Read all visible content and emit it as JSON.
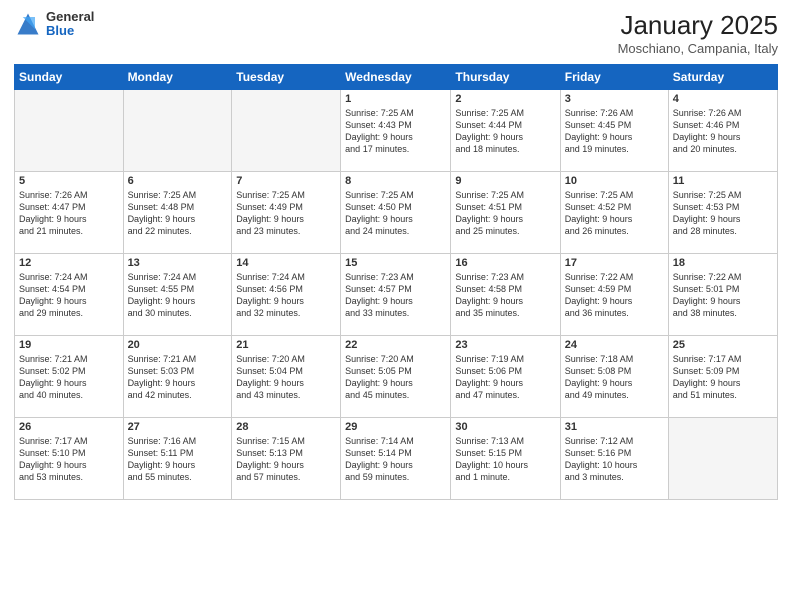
{
  "header": {
    "logo_general": "General",
    "logo_blue": "Blue",
    "month_title": "January 2025",
    "location": "Moschiano, Campania, Italy"
  },
  "days_of_week": [
    "Sunday",
    "Monday",
    "Tuesday",
    "Wednesday",
    "Thursday",
    "Friday",
    "Saturday"
  ],
  "weeks": [
    [
      {
        "num": "",
        "info": ""
      },
      {
        "num": "",
        "info": ""
      },
      {
        "num": "",
        "info": ""
      },
      {
        "num": "1",
        "info": "Sunrise: 7:25 AM\nSunset: 4:43 PM\nDaylight: 9 hours\nand 17 minutes."
      },
      {
        "num": "2",
        "info": "Sunrise: 7:25 AM\nSunset: 4:44 PM\nDaylight: 9 hours\nand 18 minutes."
      },
      {
        "num": "3",
        "info": "Sunrise: 7:26 AM\nSunset: 4:45 PM\nDaylight: 9 hours\nand 19 minutes."
      },
      {
        "num": "4",
        "info": "Sunrise: 7:26 AM\nSunset: 4:46 PM\nDaylight: 9 hours\nand 20 minutes."
      }
    ],
    [
      {
        "num": "5",
        "info": "Sunrise: 7:26 AM\nSunset: 4:47 PM\nDaylight: 9 hours\nand 21 minutes."
      },
      {
        "num": "6",
        "info": "Sunrise: 7:25 AM\nSunset: 4:48 PM\nDaylight: 9 hours\nand 22 minutes."
      },
      {
        "num": "7",
        "info": "Sunrise: 7:25 AM\nSunset: 4:49 PM\nDaylight: 9 hours\nand 23 minutes."
      },
      {
        "num": "8",
        "info": "Sunrise: 7:25 AM\nSunset: 4:50 PM\nDaylight: 9 hours\nand 24 minutes."
      },
      {
        "num": "9",
        "info": "Sunrise: 7:25 AM\nSunset: 4:51 PM\nDaylight: 9 hours\nand 25 minutes."
      },
      {
        "num": "10",
        "info": "Sunrise: 7:25 AM\nSunset: 4:52 PM\nDaylight: 9 hours\nand 26 minutes."
      },
      {
        "num": "11",
        "info": "Sunrise: 7:25 AM\nSunset: 4:53 PM\nDaylight: 9 hours\nand 28 minutes."
      }
    ],
    [
      {
        "num": "12",
        "info": "Sunrise: 7:24 AM\nSunset: 4:54 PM\nDaylight: 9 hours\nand 29 minutes."
      },
      {
        "num": "13",
        "info": "Sunrise: 7:24 AM\nSunset: 4:55 PM\nDaylight: 9 hours\nand 30 minutes."
      },
      {
        "num": "14",
        "info": "Sunrise: 7:24 AM\nSunset: 4:56 PM\nDaylight: 9 hours\nand 32 minutes."
      },
      {
        "num": "15",
        "info": "Sunrise: 7:23 AM\nSunset: 4:57 PM\nDaylight: 9 hours\nand 33 minutes."
      },
      {
        "num": "16",
        "info": "Sunrise: 7:23 AM\nSunset: 4:58 PM\nDaylight: 9 hours\nand 35 minutes."
      },
      {
        "num": "17",
        "info": "Sunrise: 7:22 AM\nSunset: 4:59 PM\nDaylight: 9 hours\nand 36 minutes."
      },
      {
        "num": "18",
        "info": "Sunrise: 7:22 AM\nSunset: 5:01 PM\nDaylight: 9 hours\nand 38 minutes."
      }
    ],
    [
      {
        "num": "19",
        "info": "Sunrise: 7:21 AM\nSunset: 5:02 PM\nDaylight: 9 hours\nand 40 minutes."
      },
      {
        "num": "20",
        "info": "Sunrise: 7:21 AM\nSunset: 5:03 PM\nDaylight: 9 hours\nand 42 minutes."
      },
      {
        "num": "21",
        "info": "Sunrise: 7:20 AM\nSunset: 5:04 PM\nDaylight: 9 hours\nand 43 minutes."
      },
      {
        "num": "22",
        "info": "Sunrise: 7:20 AM\nSunset: 5:05 PM\nDaylight: 9 hours\nand 45 minutes."
      },
      {
        "num": "23",
        "info": "Sunrise: 7:19 AM\nSunset: 5:06 PM\nDaylight: 9 hours\nand 47 minutes."
      },
      {
        "num": "24",
        "info": "Sunrise: 7:18 AM\nSunset: 5:08 PM\nDaylight: 9 hours\nand 49 minutes."
      },
      {
        "num": "25",
        "info": "Sunrise: 7:17 AM\nSunset: 5:09 PM\nDaylight: 9 hours\nand 51 minutes."
      }
    ],
    [
      {
        "num": "26",
        "info": "Sunrise: 7:17 AM\nSunset: 5:10 PM\nDaylight: 9 hours\nand 53 minutes."
      },
      {
        "num": "27",
        "info": "Sunrise: 7:16 AM\nSunset: 5:11 PM\nDaylight: 9 hours\nand 55 minutes."
      },
      {
        "num": "28",
        "info": "Sunrise: 7:15 AM\nSunset: 5:13 PM\nDaylight: 9 hours\nand 57 minutes."
      },
      {
        "num": "29",
        "info": "Sunrise: 7:14 AM\nSunset: 5:14 PM\nDaylight: 9 hours\nand 59 minutes."
      },
      {
        "num": "30",
        "info": "Sunrise: 7:13 AM\nSunset: 5:15 PM\nDaylight: 10 hours\nand 1 minute."
      },
      {
        "num": "31",
        "info": "Sunrise: 7:12 AM\nSunset: 5:16 PM\nDaylight: 10 hours\nand 3 minutes."
      },
      {
        "num": "",
        "info": ""
      }
    ]
  ]
}
